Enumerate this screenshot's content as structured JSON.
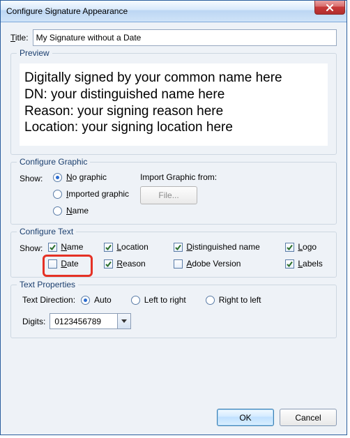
{
  "window": {
    "title": "Configure Signature Appearance"
  },
  "titleRow": {
    "label_pre": "T",
    "label_post": "itle:",
    "value": "My Signature without a Date"
  },
  "preview": {
    "legend": "Preview",
    "lines": [
      "Digitally signed by your common name here",
      "DN: your distinguished name here",
      "Reason: your signing reason here",
      "Location: your signing location here"
    ]
  },
  "graphic": {
    "legend": "Configure Graphic",
    "show_label": "Show:",
    "options": {
      "no_graphic_pre": "N",
      "no_graphic_post": "o graphic",
      "imported_pre": "I",
      "imported_post": "mported graphic",
      "name_pre": "N",
      "name_post": "ame"
    },
    "import_label": "Import Graphic from:",
    "file_btn": "File..."
  },
  "text": {
    "legend": "Configure Text",
    "show_label": "Show:",
    "checks": {
      "name": {
        "pre": "N",
        "post": "ame",
        "checked": true
      },
      "location": {
        "pre": "L",
        "post": "ocation",
        "checked": true
      },
      "distinguished": {
        "pre": "D",
        "post": "istinguished name",
        "checked": true
      },
      "logo": {
        "pre": "L",
        "post": "ogo",
        "checked": true
      },
      "date": {
        "pre": "D",
        "post": "ate",
        "checked": false
      },
      "reason": {
        "pre": "R",
        "post": "eason",
        "checked": true
      },
      "adobe": {
        "pre": "A",
        "post": "dobe Version",
        "checked": false
      },
      "labels": {
        "pre": "L",
        "post": "abels",
        "checked": true
      }
    }
  },
  "textprops": {
    "legend": "Text Properties",
    "direction_label": "Text Direction:",
    "auto": "Auto",
    "ltr": "Left to right",
    "rtl": "Right to left",
    "digits_label": "Digits:",
    "digits_value": "0123456789"
  },
  "footer": {
    "ok": "OK",
    "cancel": "Cancel"
  }
}
